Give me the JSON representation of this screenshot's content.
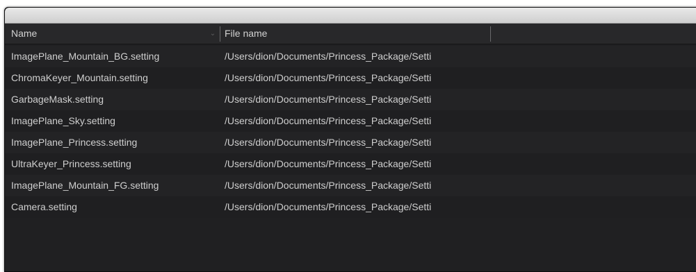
{
  "table": {
    "headers": {
      "name": "Name",
      "file_name": "File name"
    },
    "rows": [
      {
        "name": "ImagePlane_Mountain_BG.setting",
        "file": "/Users/dion/Documents/Princess_Package/Setti"
      },
      {
        "name": "ChromaKeyer_Mountain.setting",
        "file": "/Users/dion/Documents/Princess_Package/Setti"
      },
      {
        "name": "GarbageMask.setting",
        "file": "/Users/dion/Documents/Princess_Package/Setti"
      },
      {
        "name": "ImagePlane_Sky.setting",
        "file": "/Users/dion/Documents/Princess_Package/Setti"
      },
      {
        "name": "ImagePlane_Princess.setting",
        "file": "/Users/dion/Documents/Princess_Package/Setti"
      },
      {
        "name": "UltraKeyer_Princess.setting",
        "file": "/Users/dion/Documents/Princess_Package/Setti"
      },
      {
        "name": "ImagePlane_Mountain_FG.setting",
        "file": "/Users/dion/Documents/Princess_Package/Setti"
      },
      {
        "name": "Camera.setting",
        "file": "/Users/dion/Documents/Princess_Package/Setti"
      }
    ]
  }
}
